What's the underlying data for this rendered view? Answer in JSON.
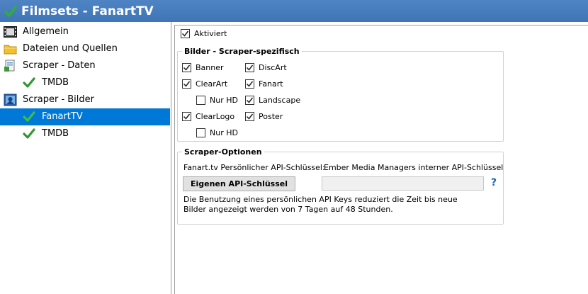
{
  "window": {
    "title": "Filmsets - FanartTV"
  },
  "nav": {
    "items": [
      {
        "label": "Allgemein",
        "icon": "film-icon"
      },
      {
        "label": "Dateien und Quellen",
        "icon": "folder-icon"
      },
      {
        "label": "Scraper - Daten",
        "icon": "scraper-data-icon"
      },
      {
        "label": "TMDB",
        "icon": "check-icon"
      },
      {
        "label": "Scraper - Bilder",
        "icon": "scraper-images-icon"
      },
      {
        "label": "FanartTV",
        "icon": "check-icon",
        "selected": true
      },
      {
        "label": "TMDB",
        "icon": "check-icon"
      }
    ]
  },
  "panel": {
    "enabled": {
      "label": "Aktiviert",
      "checked": true
    },
    "images_group": {
      "title": "Bilder - Scraper-spezifisch",
      "banner": {
        "label": "Banner",
        "checked": true
      },
      "clearart": {
        "label": "ClearArt",
        "checked": true
      },
      "clearart_hd": {
        "label": "Nur HD",
        "checked": false
      },
      "clearlogo": {
        "label": "ClearLogo",
        "checked": true
      },
      "clearlogo_hd": {
        "label": "Nur HD",
        "checked": false
      },
      "discart": {
        "label": "DiscArt",
        "checked": true
      },
      "fanart": {
        "label": "Fanart",
        "checked": true
      },
      "landscape": {
        "label": "Landscape",
        "checked": true
      },
      "poster": {
        "label": "Poster",
        "checked": true
      }
    },
    "options_group": {
      "title": "Scraper-Optionen",
      "api_key_label": "Fanart.tv Persönlicher API-Schlüssel:",
      "api_key_internal": "Ember Media Managers interner API-Schlüssel",
      "own_key_button": "Eigenen API-Schlüssel",
      "api_key_value": "",
      "help": "?",
      "description": "Die Benutzung eines persönlichen API Keys reduziert die Zeit bis neue Bilder angezeigt werden von 7 Tagen auf 48 Stunden."
    }
  },
  "colors": {
    "selection": "#0078d7",
    "titlebar": "#4a7ec0",
    "check_green": "#2e9a2e"
  }
}
